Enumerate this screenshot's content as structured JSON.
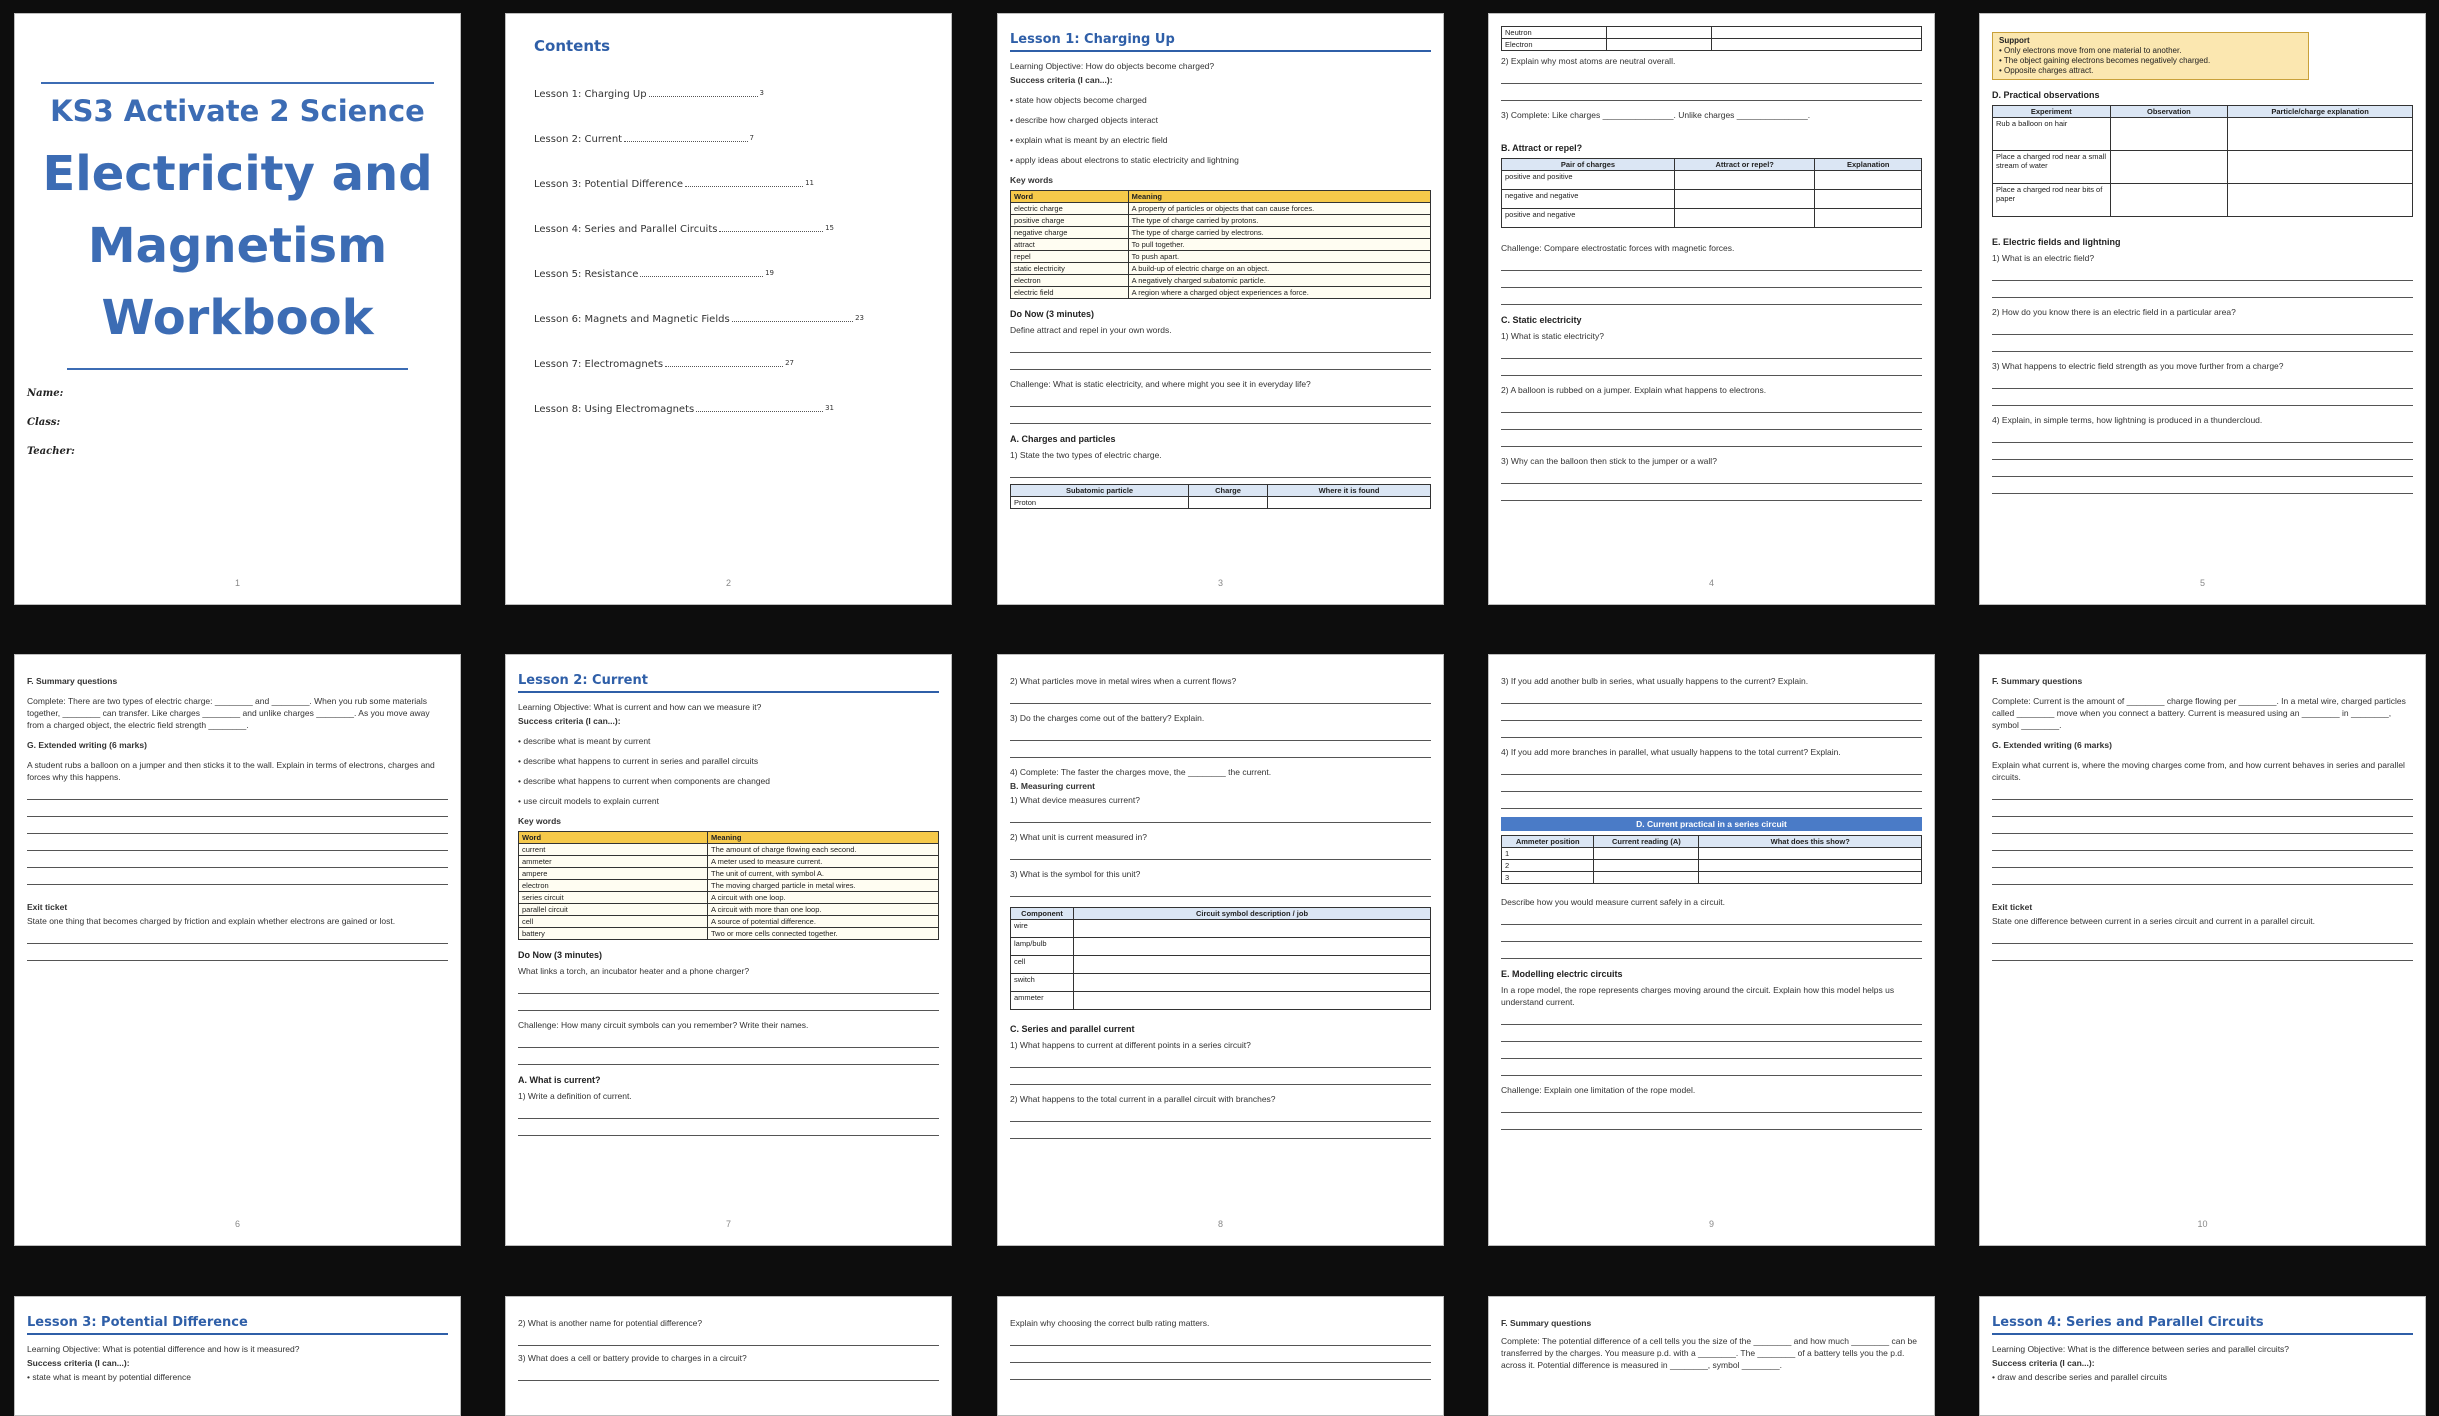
{
  "cover": {
    "subtitle": "KS3 Activate 2 Science",
    "title_l1": "Electricity and",
    "title_l2": "Magnetism",
    "title_l3": "Workbook",
    "name": "Name:",
    "class": "Class:",
    "teacher": "Teacher:",
    "page": "1"
  },
  "contents": {
    "title": "Contents",
    "items": [
      {
        "label": "Lesson 1: Charging Up",
        "page": "3"
      },
      {
        "label": "Lesson 2: Current",
        "page": "7"
      },
      {
        "label": "Lesson 3: Potential Difference",
        "page": "11"
      },
      {
        "label": "Lesson 4: Series and Parallel Circuits",
        "page": "15"
      },
      {
        "label": "Lesson 5: Resistance",
        "page": "19"
      },
      {
        "label": "Lesson 6: Magnets and Magnetic Fields",
        "page": "23"
      },
      {
        "label": "Lesson 7: Electromagnets",
        "page": "27"
      },
      {
        "label": "Lesson 8: Using Electromagnets",
        "page": "31"
      }
    ],
    "page": "2"
  },
  "p3": {
    "title": "Lesson 1: Charging Up",
    "objective": "Learning Objective: How do objects become charged?",
    "success": "Success criteria (I can...):",
    "criteria": [
      "• state how objects become charged",
      "• describe how charged objects interact",
      "• explain what is meant by an electric field",
      "• apply ideas about electrons to static electricity and lightning"
    ],
    "keywords": "Key words",
    "kw_head": [
      "Word",
      "Meaning"
    ],
    "kw_rows": [
      [
        "electric charge",
        "A property of particles or objects that can cause forces."
      ],
      [
        "positive charge",
        "The type of charge carried by protons."
      ],
      [
        "negative charge",
        "The type of charge carried by electrons."
      ],
      [
        "attract",
        "To pull together."
      ],
      [
        "repel",
        "To push apart."
      ],
      [
        "static electricity",
        "A build-up of electric charge on an object."
      ],
      [
        "electron",
        "A negatively charged subatomic particle."
      ],
      [
        "electric field",
        "A region where a charged object experiences a force."
      ]
    ],
    "donow": "Do Now (3 minutes)",
    "donow_q": "Define attract and repel in your own words.",
    "challenge": "Challenge: What is static electricity, and where might you see it in everyday life?",
    "secA": "A. Charges and particles",
    "qA1": "1) State the two types of electric charge.",
    "sp_head": [
      "Subatomic particle",
      "Charge",
      "Where it is found"
    ],
    "sp_row": "Proton",
    "page": "3"
  },
  "p4": {
    "rows_top": [
      "Neutron",
      "Electron"
    ],
    "q2": "2) Explain why most atoms are neutral overall.",
    "q3": "3) Complete: Like charges _______________. Unlike charges _______________.",
    "secB": "B. Attract or repel?",
    "b_head": [
      "Pair of charges",
      "Attract or repel?",
      "Explanation"
    ],
    "b_rows": [
      "positive and positive",
      "negative and negative",
      "positive and negative"
    ],
    "challenge": "Challenge: Compare electrostatic forces with magnetic forces.",
    "secC": "C. Static electricity",
    "c1": "1) What is static electricity?",
    "c2": "2) A balloon is rubbed on a jumper. Explain what happens to electrons.",
    "c3": "3) Why can the balloon then stick to the jumper or a wall?",
    "page": "4"
  },
  "p5": {
    "support_title": "Support",
    "support": [
      "• Only electrons move from one material to another.",
      "• The object gaining electrons becomes negatively charged.",
      "• Opposite charges attract."
    ],
    "secD": "D. Practical observations",
    "d_head": [
      "Experiment",
      "Observation",
      "Particle/charge explanation"
    ],
    "d_rows": [
      "Rub a balloon on hair",
      "Place a charged rod near a small stream of water",
      "Place a charged rod near bits of paper"
    ],
    "secE": "E. Electric fields and lightning",
    "e1": "1) What is an electric field?",
    "e2": "2) How do you know there is an electric field in a particular area?",
    "e3": "3) What happens to electric field strength as you move further from a charge?",
    "e4": "4) Explain, in simple terms, how lightning is produced in a thundercloud.",
    "page": "5"
  },
  "p6": {
    "secF": "F. Summary questions",
    "f_text": "Complete: There are two types of electric charge: ________ and ________. When you rub some materials together, ________ can transfer. Like charges ________ and unlike charges ________. As you move away from a charged object, the electric field strength ________.",
    "secG": "G. Extended writing (6 marks)",
    "g_text": "A student rubs a balloon on a jumper and then sticks it to the wall. Explain in terms of electrons, charges and forces why this happens.",
    "exit": "Exit ticket",
    "exit_text": "State one thing that becomes charged by friction and explain whether electrons are gained or lost.",
    "page": "6"
  },
  "p7": {
    "title": "Lesson 2: Current",
    "objective": "Learning Objective: What is current and how can we measure it?",
    "success": "Success criteria (I can...):",
    "criteria": [
      "• describe what is meant by current",
      "• describe what happens to current in series and parallel circuits",
      "• describe what happens to current when components are changed",
      "• use circuit models to explain current"
    ],
    "keywords": "Key words",
    "kw_head": [
      "Word",
      "Meaning"
    ],
    "kw_rows": [
      [
        "current",
        "The amount of charge flowing each second."
      ],
      [
        "ammeter",
        "A meter used to measure current."
      ],
      [
        "ampere",
        "The unit of current, with symbol A."
      ],
      [
        "electron",
        "The moving charged particle in metal wires."
      ],
      [
        "series circuit",
        "A circuit with one loop."
      ],
      [
        "parallel circuit",
        "A circuit with more than one loop."
      ],
      [
        "cell",
        "A source of potential difference."
      ],
      [
        "battery",
        "Two or more cells connected together."
      ]
    ],
    "donow": "Do Now (3 minutes)",
    "donow_q": "What links a torch, an incubator heater and a phone charger?",
    "challenge": "Challenge: How many circuit symbols can you remember? Write their names.",
    "secA": "A. What is current?",
    "qA1": "1) Write a definition of current.",
    "page": "7"
  },
  "p8": {
    "q2": "2) What particles move in metal wires when a current flows?",
    "q3": "3) Do the charges come out of the battery? Explain.",
    "q4": "4) Complete: The faster the charges move, the ________ the current.",
    "secB": "B. Measuring current",
    "b1": "1) What device measures current?",
    "b2": "2) What unit is current measured in?",
    "b3": "3) What is the symbol for this unit?",
    "comp_head": [
      "Component",
      "Circuit symbol description / job"
    ],
    "comp_rows": [
      "wire",
      "lamp/bulb",
      "cell",
      "switch",
      "ammeter"
    ],
    "secC": "C. Series and parallel current",
    "c1": "1) What happens to current at different points in a series circuit?",
    "c2": "2) What happens to the total current in a parallel circuit with branches?",
    "page": "8"
  },
  "p9": {
    "q3": "3) If you add another bulb in series, what usually happens to the current? Explain.",
    "q4": "4) If you add more branches in parallel, what usually happens to the total current? Explain.",
    "band": "D. Current practical in a series circuit",
    "d_head": [
      "Ammeter position",
      "Current reading (A)",
      "What does this show?"
    ],
    "d_rows": [
      "1",
      "2",
      "3"
    ],
    "d_q": "Describe how you would measure current safely in a circuit.",
    "secE": "E. Modelling electric circuits",
    "e_text": "In a rope model, the rope represents charges moving around the circuit. Explain how this model helps us understand current.",
    "challenge": "Challenge: Explain one limitation of the rope model.",
    "page": "9"
  },
  "p10": {
    "secF": "F. Summary questions",
    "f_text": "Complete: Current is the amount of ________ charge flowing per ________. In a metal wire, charged particles called ________ move when you connect a battery. Current is measured using an ________ in ________, symbol ________.",
    "secG": "G. Extended writing (6 marks)",
    "g_text": "Explain what current is, where the moving charges come from, and how current behaves in series and parallel circuits.",
    "exit": "Exit ticket",
    "exit_text": "State one difference between current in a series circuit and current in a parallel circuit.",
    "page": "10"
  },
  "p11": {
    "title": "Lesson 3: Potential Difference",
    "objective": "Learning Objective: What is potential difference and how is it measured?",
    "success": "Success criteria (I can...):",
    "c1": "• state what is meant by potential difference"
  },
  "p12": {
    "q2": "2) What is another name for potential difference?",
    "q3": "3) What does a cell or battery provide to charges in a circuit?"
  },
  "p13": {
    "q": "Explain why choosing the correct bulb rating matters."
  },
  "p14": {
    "secF": "F. Summary questions",
    "f_text": "Complete: The potential difference of a cell tells you the size of the ________ and how much ________ can be transferred by the charges. You measure p.d. with a ________. The ________ of a battery tells you the p.d. across it. Potential difference is measured in ________, symbol ________."
  },
  "p15": {
    "title": "Lesson 4: Series and Parallel Circuits",
    "objective": "Learning Objective: What is the difference between series and parallel circuits?",
    "success": "Success criteria (I can...):",
    "c1": "• draw and describe series and parallel circuits"
  }
}
